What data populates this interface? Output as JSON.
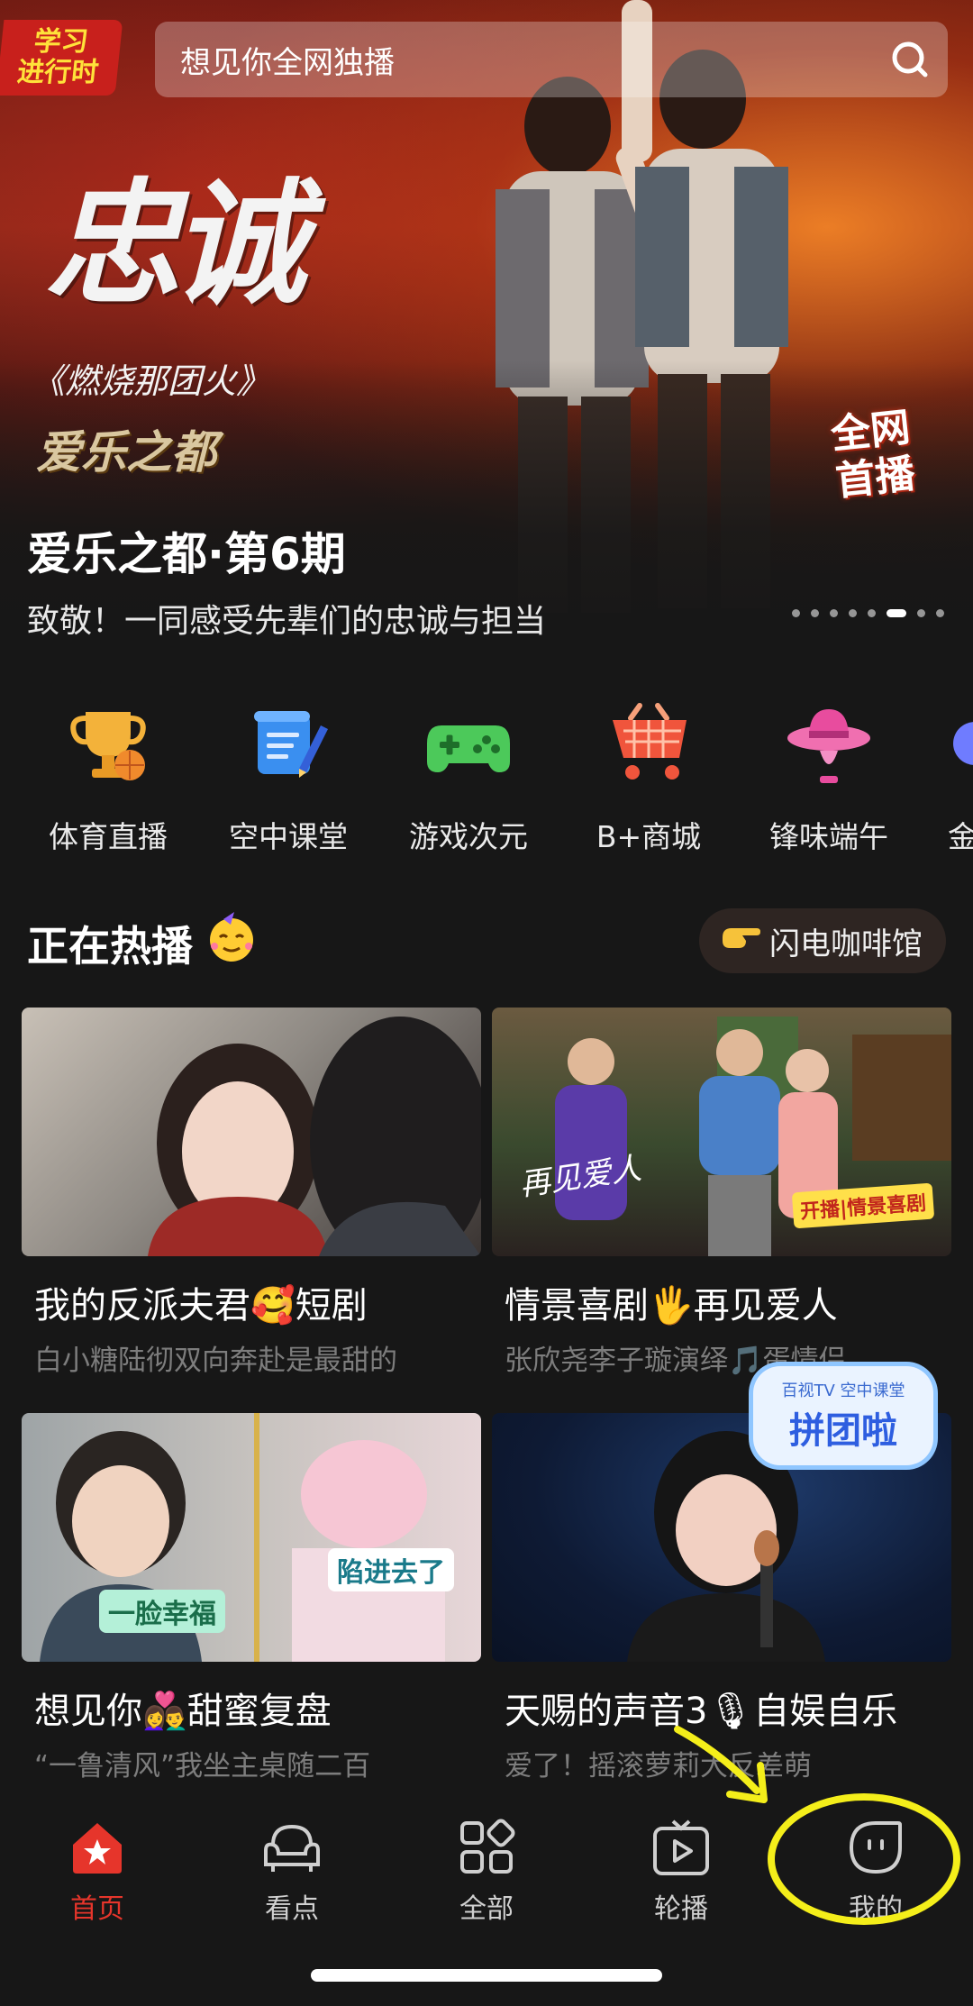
{
  "header": {
    "badge_line1": "学习",
    "badge_line2": "进行时",
    "search_placeholder": "想见你全网独播"
  },
  "hero": {
    "calligraphy": "忠诚",
    "calligraphy_sub": "《燃烧那团火》",
    "show_logo": "爱乐之都",
    "premiere_line1": "全网",
    "premiere_line2": "首播",
    "title": "爱乐之都·第6期",
    "subtitle": "致敬！一同感受先辈们的忠诚与担当",
    "slide_count": 8,
    "active_slide": 6
  },
  "categories": [
    {
      "label": "体育直播",
      "icon": "trophy-icon"
    },
    {
      "label": "空中课堂",
      "icon": "scroll-pen-icon"
    },
    {
      "label": "游戏次元",
      "icon": "gamepad-icon"
    },
    {
      "label": "B+商城",
      "icon": "cart-icon"
    },
    {
      "label": "锋味端午",
      "icon": "hat-icon"
    },
    {
      "label": "金"
    }
  ],
  "section": {
    "title": "正在热播",
    "right_link": "闪电咖啡馆"
  },
  "cards": [
    {
      "title": "我的反派夫君🥰短剧",
      "subtitle": "白小糖陆彻双向奔赴是最甜的"
    },
    {
      "title": "情景喜剧🖐再见爱人",
      "subtitle": "张欣尧李子璇演绎🎵蛋情侣",
      "overlay_left": "再见爱人",
      "overlay_right": "开播|情景喜剧"
    },
    {
      "title": "想见你👩‍❤️‍👨甜蜜复盘",
      "subtitle": "“一鲁清风”我坐主桌随二百",
      "overlay_a": "一脸幸福",
      "overlay_b": "陷进去了"
    },
    {
      "title": "天赐的声音3🎙自娱自乐",
      "subtitle": "爱了！摇滚萝莉大反差萌",
      "overlay_sticker": "拼团啦",
      "overlay_small": "百视TV 空中课堂"
    }
  ],
  "bottom_nav": [
    {
      "label": "首页",
      "active": true
    },
    {
      "label": "看点"
    },
    {
      "label": "全部"
    },
    {
      "label": "轮播"
    },
    {
      "label": "我的"
    }
  ],
  "colors": {
    "accent": "#e6352b",
    "annotation": "#f4ee1a",
    "background": "#171717"
  }
}
